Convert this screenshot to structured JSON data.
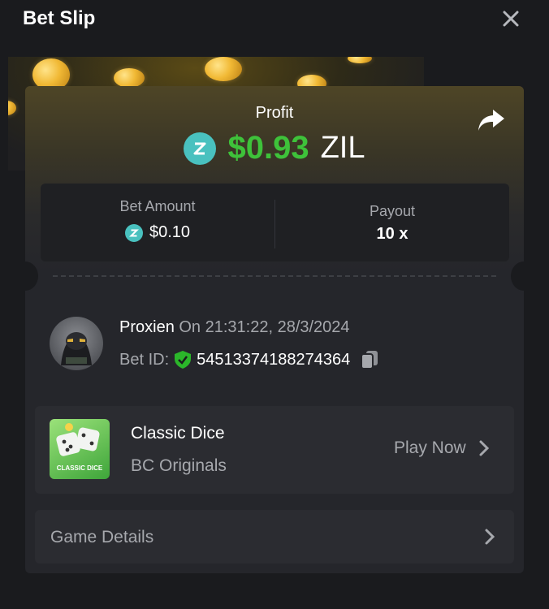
{
  "header": {
    "title": "Bet Slip"
  },
  "profit": {
    "label": "Profit",
    "amount": "$0.93",
    "currency": "ZIL"
  },
  "stats": {
    "bet_amount_label": "Bet Amount",
    "bet_amount_value": "$0.10",
    "payout_label": "Payout",
    "payout_value": "10 x"
  },
  "user": {
    "name": "Proxien",
    "time": "On 21:31:22, 28/3/2024",
    "bet_id_label": "Bet ID:",
    "bet_id": "54513374188274364"
  },
  "game": {
    "name": "Classic Dice",
    "provider": "BC Originals",
    "thumb_text": "CLASSIC DICE",
    "play_label": "Play Now"
  },
  "details": {
    "label": "Game Details"
  },
  "colors": {
    "profit_green": "#3ec23a",
    "zil_teal": "#49c1bf",
    "background": "#1a1b1e",
    "card": "#25262b"
  },
  "icons": [
    "close-icon",
    "share-icon",
    "zil-coin-icon",
    "shield-check-icon",
    "copy-icon",
    "chevron-right-icon",
    "dice-icon"
  ]
}
